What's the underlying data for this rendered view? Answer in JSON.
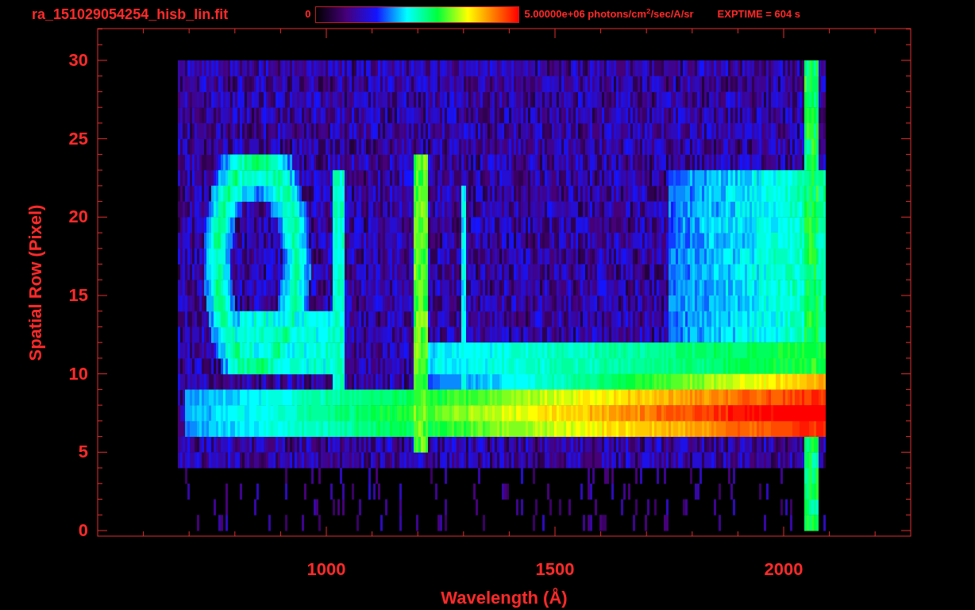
{
  "title": "ra_151029054254_hisb_lin.fit",
  "colorbar": {
    "min_label": "0",
    "max_label": "5.00000e+06 photons/cm$^{2}$/sec/A/sr"
  },
  "exptime": "EXPTIME = 604 s",
  "x_axis": {
    "label": "Wavelength (Å)",
    "ticks": [
      "1000",
      "1500",
      "2000"
    ]
  },
  "y_axis": {
    "label": "Spatial Row (Pixel)",
    "ticks": [
      "30",
      "25",
      "20",
      "15",
      "10",
      "5",
      "0"
    ]
  }
}
